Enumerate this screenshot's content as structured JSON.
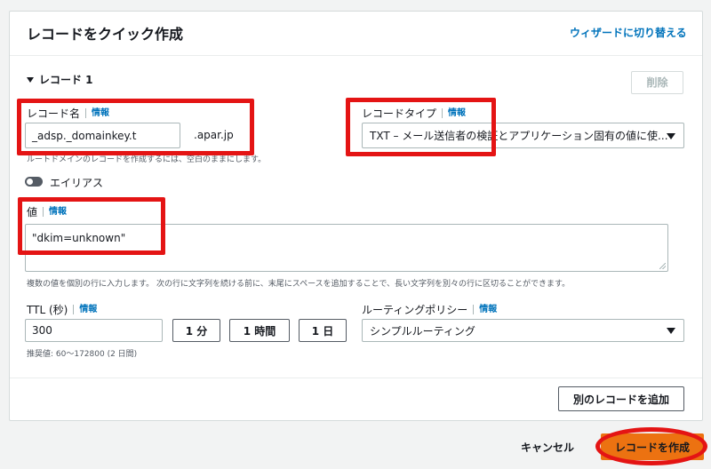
{
  "header": {
    "title": "レコードをクイック作成",
    "wizard_link": "ウィザードに切り替える"
  },
  "record": {
    "section_title": "レコード 1",
    "delete_label": "削除",
    "info_label": "情報",
    "name": {
      "label": "レコード名",
      "value": "_adsp._domainkey.t",
      "suffix": ".apar.jp",
      "hint": "ルートドメインのレコードを作成するには、空白のままにします。"
    },
    "type": {
      "label": "レコードタイプ",
      "value": "TXT – メール送信者の検証とアプリケーション固有の値に使..."
    },
    "alias": {
      "label": "エイリアス",
      "enabled": false
    },
    "value": {
      "label": "値",
      "text": "\"dkim=unknown\"",
      "hint": "複数の値を個別の行に入力します。 次の行に文字列を続ける前に、末尾にスペースを追加することで、長い文字列を別々の行に区切ることができます。"
    },
    "ttl": {
      "label": "TTL (秒)",
      "value": "300",
      "presets": [
        "1 分",
        "1 時間",
        "1 日"
      ],
      "hint": "推奨値: 60～172800 (2 日間)"
    },
    "routing": {
      "label": "ルーティングポリシー",
      "value": "シンプルルーティング"
    }
  },
  "footer": {
    "add_record_label": "別のレコードを追加",
    "cancel_label": "キャンセル",
    "create_label": "レコードを作成"
  },
  "colors": {
    "accent_link": "#0073bb",
    "primary_button": "#ec7211",
    "highlight": "#e41414"
  }
}
